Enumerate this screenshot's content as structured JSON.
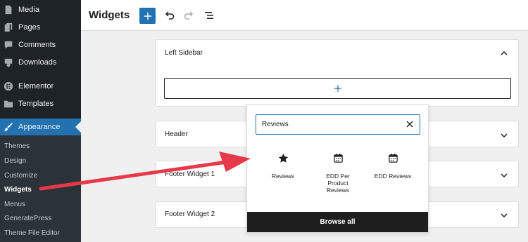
{
  "sidebar": {
    "menu": [
      {
        "label": "Media",
        "icon": "media-icon"
      },
      {
        "label": "Pages",
        "icon": "pages-icon"
      },
      {
        "label": "Comments",
        "icon": "comments-icon"
      },
      {
        "label": "Downloads",
        "icon": "download-icon"
      },
      {
        "label": "Elementor",
        "icon": "elementor-icon"
      },
      {
        "label": "Templates",
        "icon": "folder-icon"
      },
      {
        "label": "Appearance",
        "icon": "brush-icon"
      }
    ],
    "submenu": [
      "Themes",
      "Design",
      "Customize",
      "Widgets",
      "Menus",
      "GeneratePress",
      "Theme File Editor"
    ],
    "current_submenu": "Widgets"
  },
  "header": {
    "title": "Widgets"
  },
  "panels": [
    {
      "title": "Left Sidebar"
    },
    {
      "title": "Header"
    },
    {
      "title": "Footer Widget 1"
    },
    {
      "title": "Footer Widget 2"
    }
  ],
  "inserter": {
    "search_value": "Reviews",
    "results": [
      {
        "label": "Reviews",
        "icon": "star-icon"
      },
      {
        "label": "EDD Per Product Reviews",
        "label_lines": [
          "EDD Per",
          "Product",
          "Reviews"
        ],
        "icon": "calendar-icon"
      },
      {
        "label": "EDD Reviews",
        "icon": "calendar-icon"
      }
    ],
    "browse_all": "Browse all"
  },
  "colors": {
    "sidebar_bg": "#1d2327",
    "accent": "#2271b1",
    "annotation_arrow": "#e8394a"
  }
}
